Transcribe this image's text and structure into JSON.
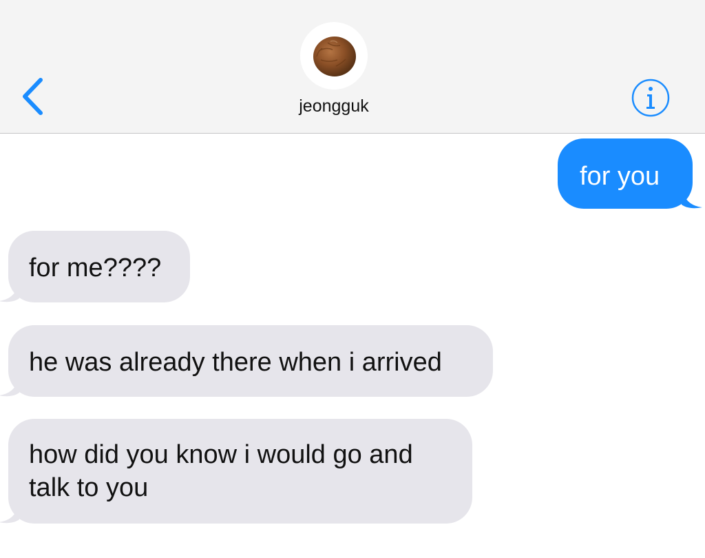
{
  "header": {
    "contact_name": "jeongguk",
    "back_icon": "chevron-left-icon",
    "info_icon": "info-icon",
    "avatar_description_icon": "coconut-icon"
  },
  "colors": {
    "accent": "#1a8cff",
    "sent_bubble": "#1a8cff",
    "received_bubble": "#e6e5eb",
    "header_bg": "#f4f4f4"
  },
  "messages": [
    {
      "direction": "sent",
      "text": "for you"
    },
    {
      "direction": "received",
      "text": "for me????"
    },
    {
      "direction": "received",
      "text": "he was already there when i arrived"
    },
    {
      "direction": "received",
      "text": "how did you know i would go and talk to you"
    }
  ]
}
